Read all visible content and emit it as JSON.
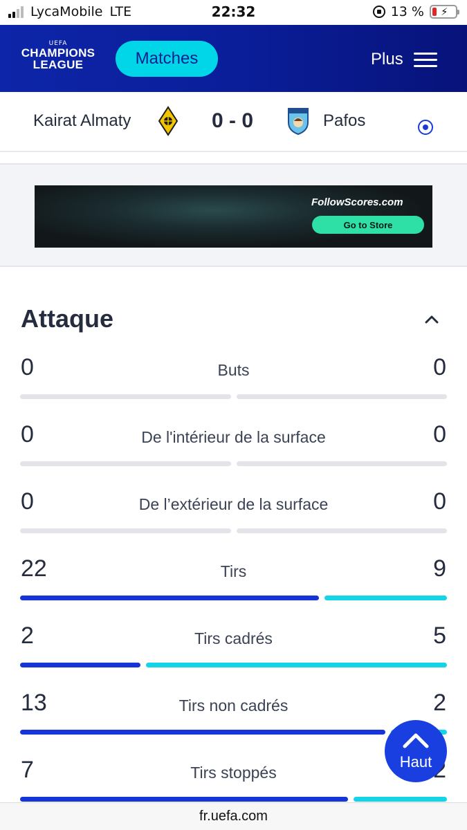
{
  "status_bar": {
    "carrier": "LycaMobile",
    "network": "LTE",
    "time": "22:32",
    "battery": "13 %"
  },
  "header": {
    "logo_top": "UEFA",
    "logo_line1": "CHAMPIONS",
    "logo_line2": "LEAGUE",
    "matches_label": "Matches",
    "plus_label": "Plus"
  },
  "match": {
    "home": "Kairat Almaty",
    "score": "0 - 0",
    "away": "Pafos"
  },
  "ad": {
    "brand": "FollowScores.com",
    "cta": "Go to Store"
  },
  "section": {
    "title": "Attaque"
  },
  "colors": {
    "home": "#1535d8",
    "away": "#14d4e8",
    "empty": "#e3e4ea"
  },
  "stats": [
    {
      "label": "Buts",
      "home": "0",
      "away": "0"
    },
    {
      "label": "De l'intérieur de la surface",
      "home": "0",
      "away": "0"
    },
    {
      "label": "De l’extérieur de la surface",
      "home": "0",
      "away": "0"
    },
    {
      "label": "Tirs",
      "home": "22",
      "away": "9"
    },
    {
      "label": "Tirs cadrés",
      "home": "2",
      "away": "5"
    },
    {
      "label": "Tirs non cadrés",
      "home": "13",
      "away": "2"
    },
    {
      "label": "Tirs stoppés",
      "home": "7",
      "away": "2"
    }
  ],
  "haut_label": "Haut",
  "url": "fr.uefa.com"
}
